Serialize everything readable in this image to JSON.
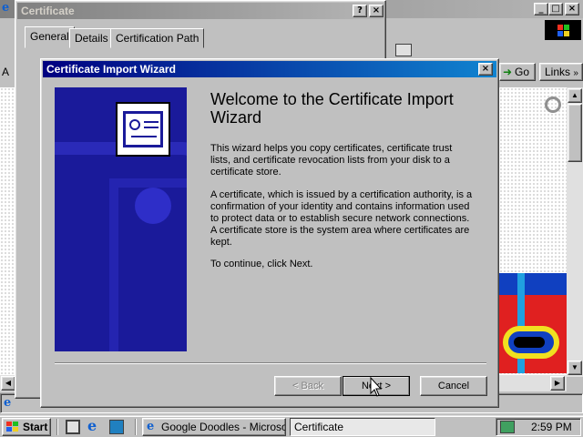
{
  "ie": {
    "go_label": "Go",
    "links_label": "Links"
  },
  "certificate": {
    "title": "Certificate",
    "tabs": [
      "General",
      "Details",
      "Certification Path"
    ]
  },
  "wizard": {
    "title": "Certificate Import Wizard",
    "heading": "Welcome to the Certificate Import Wizard",
    "para1": "This wizard helps you copy certificates, certificate trust lists, and certificate revocation lists from your disk to a certificate store.",
    "para2": "A certificate, which is issued by a certification authority, is a confirmation of your identity and contains information used to protect data or to establish secure network connections. A certificate store is the system area where certificates are kept.",
    "para3": "To continue, click Next.",
    "back_label": "< Back",
    "next_label": "Next >",
    "cancel_label": "Cancel"
  },
  "taskbar": {
    "start_label": "Start",
    "tasks": [
      "Google Doodles - Microsof...",
      "Certificate"
    ],
    "clock": "2:59 PM"
  },
  "colors": {
    "title_active": "#000080",
    "banner": "#1a1a9a"
  }
}
